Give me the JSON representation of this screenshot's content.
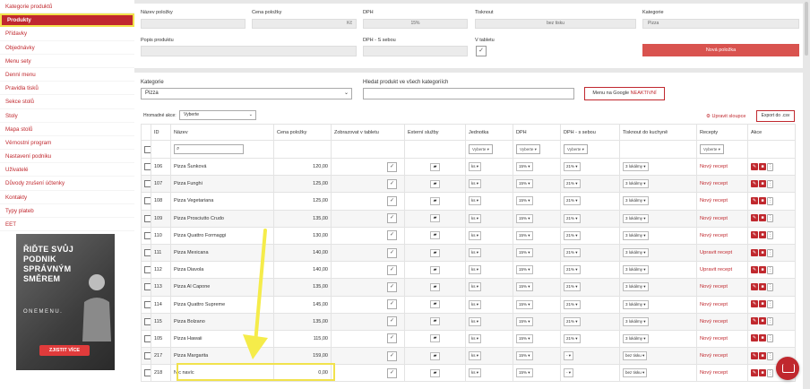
{
  "sidebar": {
    "items": [
      {
        "label": "Kategorie produktů"
      },
      {
        "label": "Produkty"
      },
      {
        "label": "Přídavky"
      },
      {
        "label": "Objednávky"
      },
      {
        "label": "Menu sety"
      },
      {
        "label": "Denní menu"
      },
      {
        "label": "Pravidla tisků"
      },
      {
        "label": "Sekce stolů"
      },
      {
        "label": "Stoly"
      },
      {
        "label": "Mapa stolů"
      },
      {
        "label": "Věrnostní program"
      },
      {
        "label": "Nastavení podniku"
      },
      {
        "label": "Uživatelé"
      },
      {
        "label": "Důvody zrušení účtenky"
      },
      {
        "label": "Kontakty"
      },
      {
        "label": "Typy plateb"
      },
      {
        "label": "EET"
      }
    ],
    "ad": {
      "title": "ŘIĎTE SVŮJ PODNIK SPRÁVNÝM SMĚREM",
      "brand": "ONEMENU.",
      "button": "ZJISTIT VÍCE"
    }
  },
  "form": {
    "name_label": "Název položky",
    "price_label": "Cena položky",
    "price_suffix": "Kč",
    "vat_label": "DPH",
    "vat_value": "15%",
    "print_label": "Tisknout",
    "print_value": "bez tisku",
    "category_label": "Kategorie",
    "category_value": "Pizza",
    "desc_label": "Popis produktu",
    "vat_takeaway_label": "DPH - S sebou",
    "in_tablet_label": "V tabletu",
    "new_item_button": "Nová položka"
  },
  "filters": {
    "category_label": "Kategorie",
    "category_value": "Pizza",
    "search_label": "Hledat produkt ve všech kategoriích",
    "google_button_prefix": "Menu na Google ",
    "google_button_status": "NEAKTIVNÍ",
    "bulk_label": "Hromadné akce:",
    "bulk_value": "Vyberte",
    "edit_columns": "Upravit sloupce",
    "export": "Export do .csv"
  },
  "table": {
    "headers": [
      "",
      "ID",
      "Název",
      "Cena položky",
      "Zobrazovat v tabletu",
      "Externí služby",
      "Jednotka",
      "DPH",
      "DPH - s sebou",
      "Tisknout do kuchyně",
      "Recepty",
      "Akce"
    ],
    "filter_select": "Vyberte",
    "rows": [
      {
        "id": "106",
        "name": "Pizza Šunková",
        "price": "120,00",
        "unit": "ks",
        "vat": "15%",
        "vat_takeaway": "21%",
        "print": "3 lokálmy",
        "recipe": "Nový recept"
      },
      {
        "id": "107",
        "name": "Pizza Funghi",
        "price": "125,00",
        "unit": "ks",
        "vat": "15%",
        "vat_takeaway": "21%",
        "print": "3 lokálmy",
        "recipe": "Nový recept"
      },
      {
        "id": "108",
        "name": "Pizza Vegetariana",
        "price": "125,00",
        "unit": "ks",
        "vat": "15%",
        "vat_takeaway": "21%",
        "print": "3 lokálmy",
        "recipe": "Nový recept"
      },
      {
        "id": "109",
        "name": "Pizza Prosciutto Crudo",
        "price": "135,00",
        "unit": "ks",
        "vat": "15%",
        "vat_takeaway": "21%",
        "print": "3 lokálmy",
        "recipe": "Nový recept"
      },
      {
        "id": "110",
        "name": "Pizza Quattro Formaggi",
        "price": "130,00",
        "unit": "ks",
        "vat": "15%",
        "vat_takeaway": "21%",
        "print": "3 lokálmy",
        "recipe": "Nový recept"
      },
      {
        "id": "111",
        "name": "Pizza Mexicana",
        "price": "140,00",
        "unit": "ks",
        "vat": "15%",
        "vat_takeaway": "21%",
        "print": "3 lokálmy",
        "recipe": "Upravit recept"
      },
      {
        "id": "112",
        "name": "Pizza Diavola",
        "price": "140,00",
        "unit": "ks",
        "vat": "15%",
        "vat_takeaway": "21%",
        "print": "3 lokálmy",
        "recipe": "Upravit recept"
      },
      {
        "id": "113",
        "name": "Pizza Al Capone",
        "price": "135,00",
        "unit": "ks",
        "vat": "15%",
        "vat_takeaway": "21%",
        "print": "3 lokálmy",
        "recipe": "Nový recept"
      },
      {
        "id": "114",
        "name": "Pizza Quattro Supreme",
        "price": "145,00",
        "unit": "ks",
        "vat": "15%",
        "vat_takeaway": "21%",
        "print": "3 lokálmy",
        "recipe": "Nový recept"
      },
      {
        "id": "115",
        "name": "Pizza Bolzano",
        "price": "135,00",
        "unit": "ks",
        "vat": "15%",
        "vat_takeaway": "21%",
        "print": "3 lokálmy",
        "recipe": "Nový recept"
      },
      {
        "id": "105",
        "name": "Pizza Hawaii",
        "price": "115,00",
        "unit": "ks",
        "vat": "15%",
        "vat_takeaway": "21%",
        "print": "3 lokálmy",
        "recipe": "Nový recept"
      },
      {
        "id": "217",
        "name": "Pizza Margarita",
        "price": "159,00",
        "unit": "ks",
        "vat": "15%",
        "vat_takeaway": "-",
        "print": "bez tisku",
        "recipe": "Nový recept"
      },
      {
        "id": "218",
        "name": "Nic navíc",
        "price": "0,00",
        "unit": "ks",
        "vat": "15%",
        "vat_takeaway": "-",
        "print": "bez tisku",
        "recipe": "Nový recept"
      }
    ]
  },
  "colors": {
    "accent": "#c0282e",
    "highlight": "#f1e24c",
    "button": "#d9534f"
  }
}
